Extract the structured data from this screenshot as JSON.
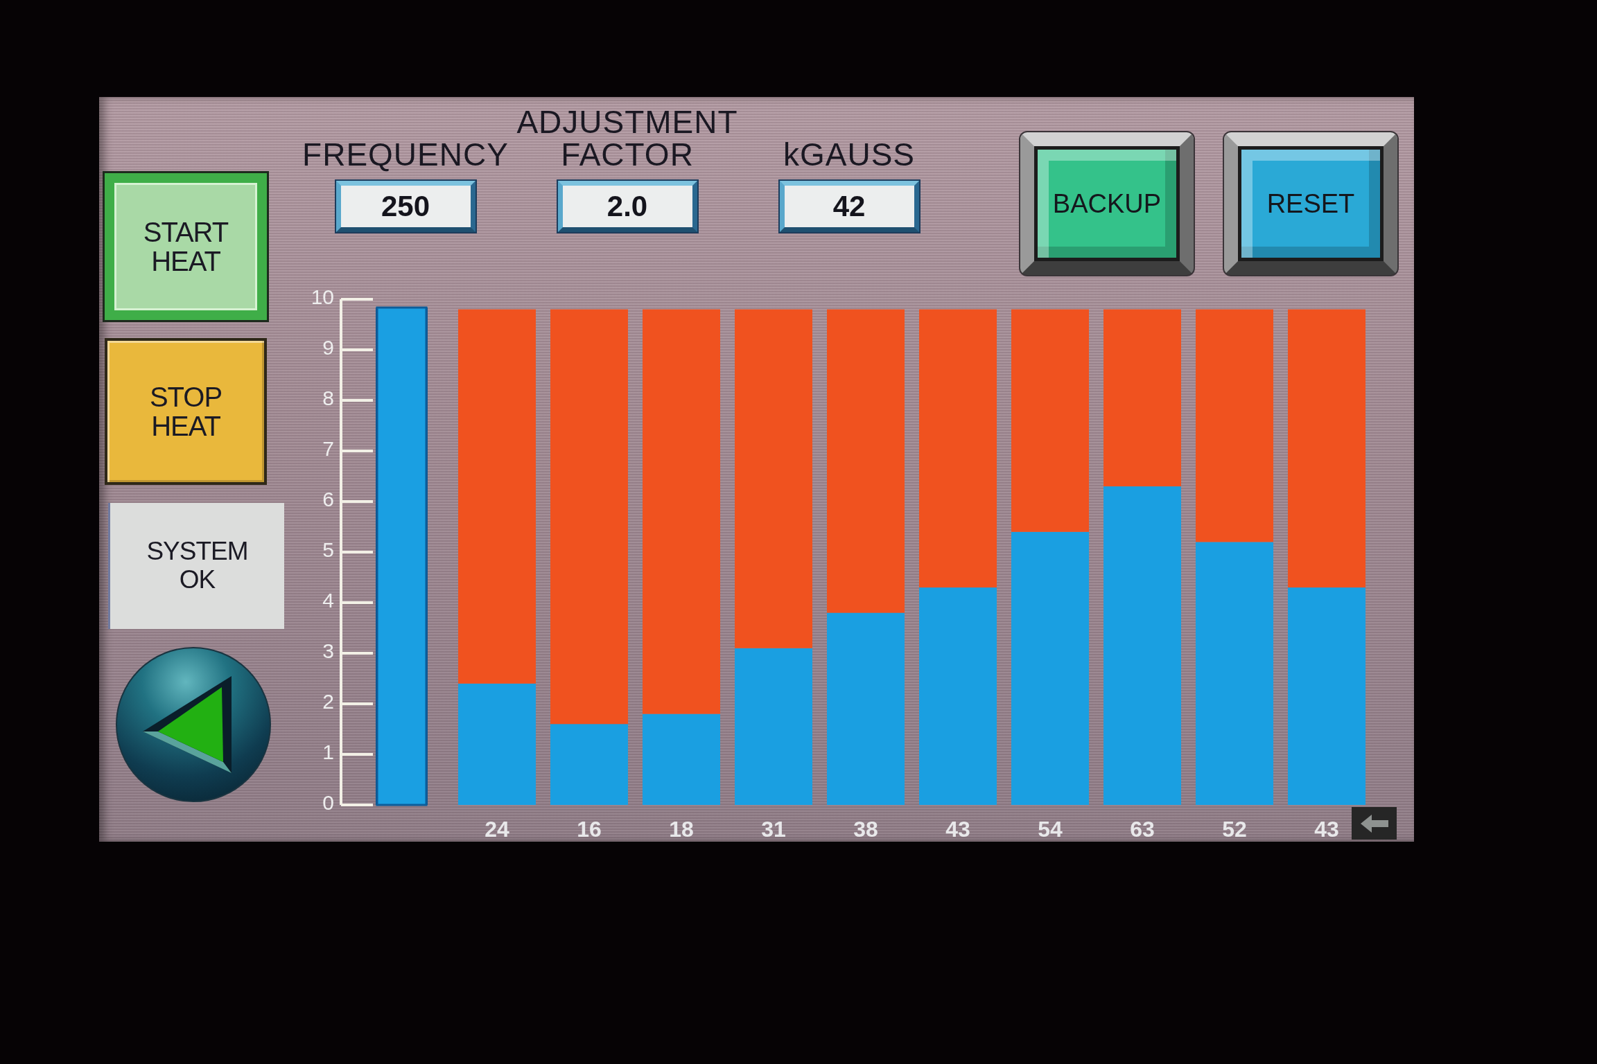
{
  "controls": [
    {
      "kind": "button",
      "label": "START HEAT",
      "color": "#a9d9a6",
      "active": true
    },
    {
      "kind": "button",
      "label": "STOP HEAT",
      "color": "#e9b83c",
      "active": false
    },
    {
      "kind": "indicator",
      "label": "SYSTEM OK",
      "color": "#dcdddc",
      "active": false
    }
  ],
  "fields": [
    {
      "label": "FREQUENCY",
      "value": "250"
    },
    {
      "label": "ADJUSTMENT FACTOR",
      "value": "2.0"
    },
    {
      "label": "kGAUSS",
      "value": "42"
    }
  ],
  "buttons": [
    {
      "label": "BACKUP",
      "color": "#34c28a"
    },
    {
      "label": "RESET",
      "color": "#2aa9d6"
    }
  ],
  "meter": {
    "level": 1
  },
  "chart": {
    "chart_data": {
      "type": "bar",
      "stacked": true,
      "categories": [
        "24",
        "16",
        "18",
        "31",
        "38",
        "43",
        "54",
        "63",
        "52",
        "43"
      ],
      "series": [
        {
          "color": "#1a9fe1",
          "values": [
            2.4,
            1.6,
            1.8,
            3.1,
            3.8,
            4.3,
            5.4,
            6.3,
            5.2,
            4.3
          ]
        },
        {
          "color": "#f0521f",
          "values": [
            7.4,
            8.2,
            8.0,
            6.7,
            6.0,
            5.5,
            4.4,
            3.5,
            4.6,
            5.5
          ]
        }
      ],
      "ylim": [
        0,
        10
      ],
      "yticks": [
        0,
        1,
        2,
        3,
        4,
        5,
        6,
        7,
        8,
        9,
        10
      ]
    }
  }
}
